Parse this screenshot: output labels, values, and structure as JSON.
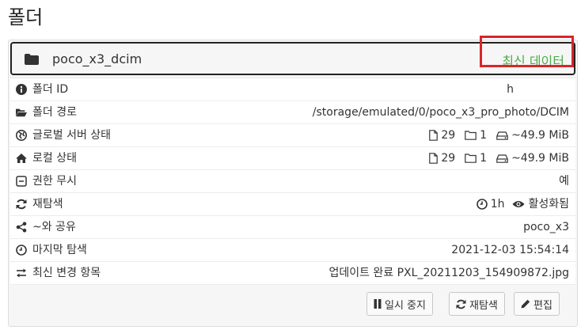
{
  "page": {
    "title": "폴더"
  },
  "folder": {
    "name": "poco_x3_dcim",
    "status": "최신 데이터",
    "status_color": "#4cae4c"
  },
  "rows": [
    {
      "icon": "info-circle-icon",
      "label": "폴더 ID",
      "value": "h"
    },
    {
      "icon": "folder-open-icon",
      "label": "폴더 경로",
      "value": "/storage/emulated/0/poco_x3_pro_photo/DCIM"
    },
    {
      "icon": "globe-icon",
      "label": "글로벌 서버 상태",
      "files": "29",
      "dirs": "1",
      "size": "~49.9 MiB"
    },
    {
      "icon": "home-icon",
      "label": "로컬 상태",
      "files": "29",
      "dirs": "1",
      "size": "~49.9 MiB"
    },
    {
      "icon": "minus-square-icon",
      "label": "권한 무시",
      "value": "예"
    },
    {
      "icon": "refresh-icon",
      "label": "재탐색",
      "interval": "1h",
      "watch": "활성화됨"
    },
    {
      "icon": "share-icon",
      "label": "~와 공유",
      "value": "poco_x3"
    },
    {
      "icon": "clock-icon",
      "label": "마지막 탐색",
      "value": "2021-12-03 15:54:14"
    },
    {
      "icon": "exchange-icon",
      "label": "최신 변경 항목",
      "value": "업데이트 완료 PXL_20211203_154909872.jpg"
    }
  ],
  "buttons": {
    "pause": "일시 중지",
    "rescan": "재탐색",
    "edit": "편집"
  },
  "colors": {
    "highlight": "#d9252a",
    "accent": "#4cae4c"
  }
}
